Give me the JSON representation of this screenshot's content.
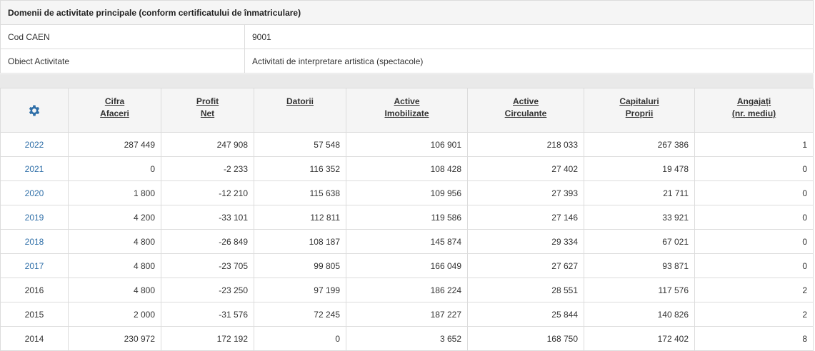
{
  "domains": {
    "title": "Domenii de activitate principale (conform certificatului de înmatriculare)",
    "rows": [
      {
        "label": "Cod CAEN",
        "value": "9001"
      },
      {
        "label": "Obiect Activitate",
        "value": "Activitati de interpretare artistica (spectacole)"
      }
    ]
  },
  "financials": {
    "settings_icon": "gear-icon",
    "icon_color": "#2f6fa8",
    "headers": [
      [
        "Cifra",
        "Afaceri"
      ],
      [
        "Profit",
        "Net"
      ],
      [
        "Datorii",
        ""
      ],
      [
        "Active",
        "Imobilizate"
      ],
      [
        "Active",
        "Circulante"
      ],
      [
        "Capitaluri",
        "Proprii"
      ],
      [
        "Angajați",
        "(nr. mediu)"
      ]
    ],
    "rows": [
      {
        "year": "2022",
        "link": true,
        "values": [
          "287 449",
          "247 908",
          "57 548",
          "106 901",
          "218 033",
          "267 386",
          "1"
        ]
      },
      {
        "year": "2021",
        "link": true,
        "values": [
          "0",
          "-2 233",
          "116 352",
          "108 428",
          "27 402",
          "19 478",
          "0"
        ]
      },
      {
        "year": "2020",
        "link": true,
        "values": [
          "1 800",
          "-12 210",
          "115 638",
          "109 956",
          "27 393",
          "21 711",
          "0"
        ]
      },
      {
        "year": "2019",
        "link": true,
        "values": [
          "4 200",
          "-33 101",
          "112 811",
          "119 586",
          "27 146",
          "33 921",
          "0"
        ]
      },
      {
        "year": "2018",
        "link": true,
        "values": [
          "4 800",
          "-26 849",
          "108 187",
          "145 874",
          "29 334",
          "67 021",
          "0"
        ]
      },
      {
        "year": "2017",
        "link": true,
        "values": [
          "4 800",
          "-23 705",
          "99 805",
          "166 049",
          "27 627",
          "93 871",
          "0"
        ]
      },
      {
        "year": "2016",
        "link": false,
        "values": [
          "4 800",
          "-23 250",
          "97 199",
          "186 224",
          "28 551",
          "117 576",
          "2"
        ]
      },
      {
        "year": "2015",
        "link": false,
        "values": [
          "2 000",
          "-31 576",
          "72 245",
          "187 227",
          "25 844",
          "140 826",
          "2"
        ]
      },
      {
        "year": "2014",
        "link": false,
        "values": [
          "230 972",
          "172 192",
          "0",
          "3 652",
          "168 750",
          "172 402",
          "8"
        ]
      }
    ]
  }
}
